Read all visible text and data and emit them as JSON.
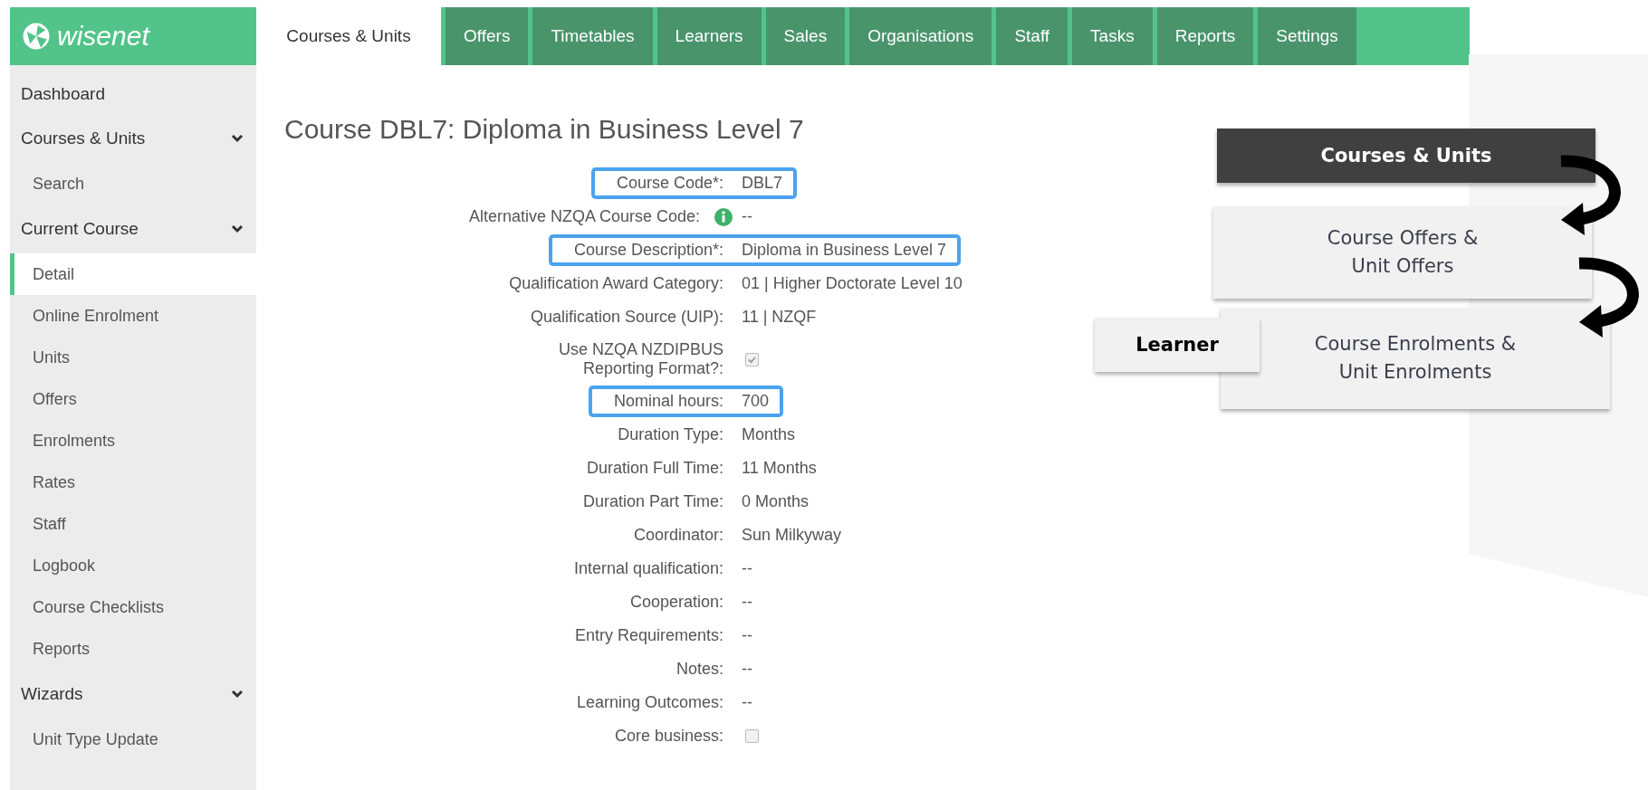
{
  "logo": {
    "text": "wisenet"
  },
  "tabs": [
    {
      "label": "Courses & Units",
      "selected": true
    },
    {
      "label": "Offers",
      "selected": false
    },
    {
      "label": "Timetables",
      "selected": false
    },
    {
      "label": "Learners",
      "selected": false
    },
    {
      "label": "Sales",
      "selected": false
    },
    {
      "label": "Organisations",
      "selected": false
    },
    {
      "label": "Staff",
      "selected": false
    },
    {
      "label": "Tasks",
      "selected": false
    },
    {
      "label": "Reports",
      "selected": false
    },
    {
      "label": "Settings",
      "selected": false
    }
  ],
  "sidebar": {
    "items": [
      {
        "kind": "link",
        "label": "Dashboard",
        "selected": false
      },
      {
        "kind": "header",
        "label": "Courses & Units",
        "expanded": true
      },
      {
        "kind": "item",
        "label": "Search",
        "selected": false
      },
      {
        "kind": "header",
        "label": "Current Course",
        "expanded": true
      },
      {
        "kind": "item",
        "label": "Detail",
        "selected": true
      },
      {
        "kind": "item",
        "label": "Online Enrolment",
        "selected": false
      },
      {
        "kind": "item",
        "label": "Units",
        "selected": false
      },
      {
        "kind": "item",
        "label": "Offers",
        "selected": false
      },
      {
        "kind": "item",
        "label": "Enrolments",
        "selected": false
      },
      {
        "kind": "item",
        "label": "Rates",
        "selected": false
      },
      {
        "kind": "item",
        "label": "Staff",
        "selected": false
      },
      {
        "kind": "item",
        "label": "Logbook",
        "selected": false
      },
      {
        "kind": "item",
        "label": "Course Checklists",
        "selected": false
      },
      {
        "kind": "item",
        "label": "Reports",
        "selected": false
      },
      {
        "kind": "header",
        "label": "Wizards",
        "expanded": true
      },
      {
        "kind": "item",
        "label": "Unit Type Update",
        "selected": false
      }
    ]
  },
  "page_title": "Course DBL7: Diploma in Business Level 7",
  "fields": [
    {
      "kind": "text",
      "label": "Course Code*:",
      "value": "DBL7",
      "highlighted": true
    },
    {
      "kind": "text",
      "label": "Alternative NZQA Course Code:",
      "value": "--",
      "info": true,
      "highlighted": false
    },
    {
      "kind": "text",
      "label": "Course Description*:",
      "value": "Diploma in Business Level 7",
      "highlighted": true
    },
    {
      "kind": "text",
      "label": "Qualification Award Category:",
      "value": "01 | Higher Doctorate Level 10",
      "highlighted": false
    },
    {
      "kind": "text",
      "label": "Qualification Source (UIP):",
      "value": "11 | NZQF",
      "highlighted": false
    },
    {
      "kind": "checkbox",
      "label": "Use NZQA NZDIPBUS Reporting Format?:",
      "checked": true,
      "highlighted": false
    },
    {
      "kind": "text",
      "label": "Nominal hours:",
      "value": "700",
      "highlighted": true
    },
    {
      "kind": "text",
      "label": "Duration Type:",
      "value": "Months",
      "highlighted": false
    },
    {
      "kind": "text",
      "label": "Duration Full Time:",
      "value": "11 Months",
      "highlighted": false
    },
    {
      "kind": "text",
      "label": "Duration Part Time:",
      "value": "0 Months",
      "highlighted": false
    },
    {
      "kind": "text",
      "label": "Coordinator:",
      "value": "Sun Milkyway",
      "highlighted": false
    },
    {
      "kind": "text",
      "label": "Internal qualification:",
      "value": "--",
      "highlighted": false
    },
    {
      "kind": "text",
      "label": "Cooperation:",
      "value": "--",
      "highlighted": false
    },
    {
      "kind": "text",
      "label": "Entry Requirements:",
      "value": "--",
      "highlighted": false
    },
    {
      "kind": "text",
      "label": "Notes:",
      "value": "--",
      "highlighted": false
    },
    {
      "kind": "text",
      "label": "Learning Outcomes:",
      "value": "--",
      "highlighted": false
    },
    {
      "kind": "checkbox",
      "label": "Core business:",
      "checked": false,
      "highlighted": false
    }
  ],
  "diagram": {
    "top": "Courses & Units",
    "middle": "Course Offers & Unit Offers",
    "bottom": "Course Enrolments & Unit Enrolments",
    "side": "Learner"
  }
}
